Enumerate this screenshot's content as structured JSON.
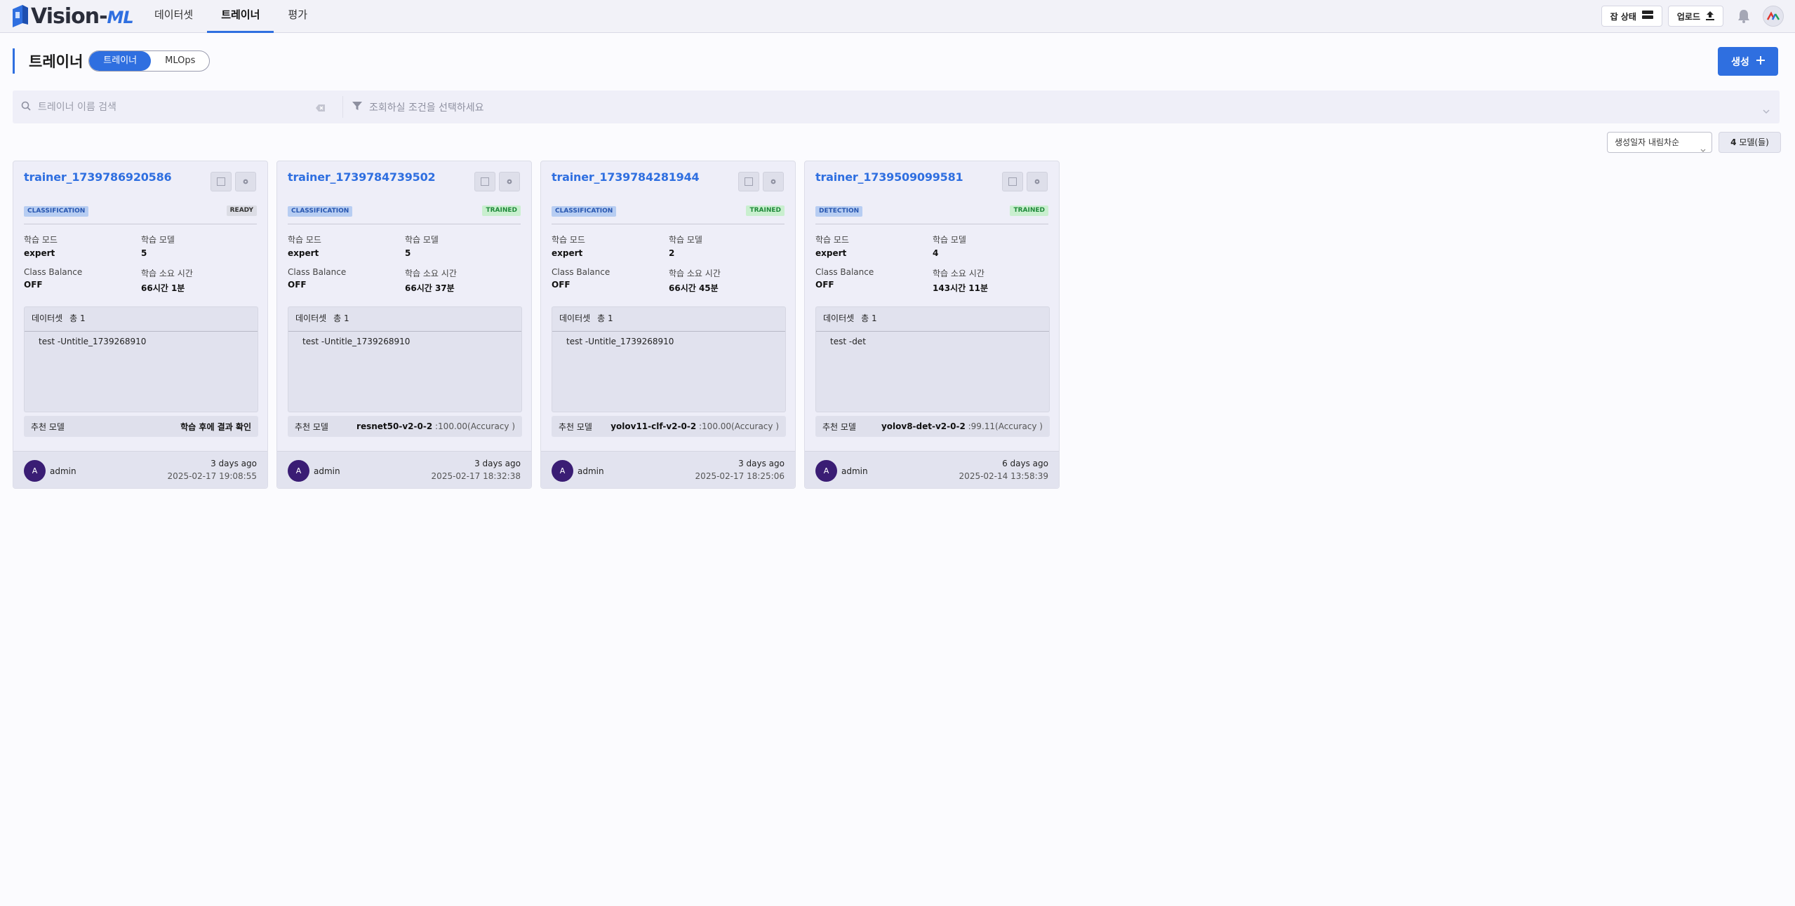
{
  "header": {
    "logo": {
      "text_main": "Vision-",
      "text_accent": "ML"
    },
    "nav": [
      {
        "label": "데이터셋",
        "active": false
      },
      {
        "label": "트레이너",
        "active": true
      },
      {
        "label": "평가",
        "active": false
      }
    ],
    "job_status_label": "잡 상태",
    "upload_label": "업로드"
  },
  "page": {
    "title": "트레이너",
    "toggle": [
      "트레이너",
      "MLOps"
    ],
    "create_label": "생성"
  },
  "filters": {
    "search_placeholder": "트레이너 이름 검색",
    "condition_placeholder": "조회하실 조건을 선택하세요"
  },
  "sort": {
    "selected": "생성일자 내림차순"
  },
  "count": {
    "value": "4",
    "unit": "모델(들)"
  },
  "labels": {
    "mode": "학습 모드",
    "model": "학습 모델",
    "class_balance": "Class Balance",
    "duration": "학습 소요 시간",
    "dataset": "데이터셋",
    "recommended": "추천 모델"
  },
  "cards": [
    {
      "title": "trainer_1739786920586",
      "type": "CLASSIFICATION",
      "status": "READY",
      "mode": "expert",
      "model_count": "5",
      "class_balance": "OFF",
      "duration": "66시간 1분",
      "dataset_total": "총 1",
      "datasets": [
        "test -Untitle_1739268910"
      ],
      "rec_model": "학습 후에 결과 확인",
      "rec_score": "",
      "author": "admin",
      "avatar": "A",
      "ago": "3 days ago",
      "timestamp": "2025-02-17 19:08:55"
    },
    {
      "title": "trainer_1739784739502",
      "type": "CLASSIFICATION",
      "status": "TRAINED",
      "mode": "expert",
      "model_count": "5",
      "class_balance": "OFF",
      "duration": "66시간 37분",
      "dataset_total": "총 1",
      "datasets": [
        "test -Untitle_1739268910"
      ],
      "rec_model": "resnet50-v2-0-2",
      "rec_score": " :100.00(Accuracy )",
      "author": "admin",
      "avatar": "A",
      "ago": "3 days ago",
      "timestamp": "2025-02-17 18:32:38"
    },
    {
      "title": "trainer_1739784281944",
      "type": "CLASSIFICATION",
      "status": "TRAINED",
      "mode": "expert",
      "model_count": "2",
      "class_balance": "OFF",
      "duration": "66시간 45분",
      "dataset_total": "총 1",
      "datasets": [
        "test -Untitle_1739268910"
      ],
      "rec_model": "yolov11-clf-v2-0-2",
      "rec_score": " :100.00(Accuracy )",
      "author": "admin",
      "avatar": "A",
      "ago": "3 days ago",
      "timestamp": "2025-02-17 18:25:06"
    },
    {
      "title": "trainer_1739509099581",
      "type": "DETECTION",
      "status": "TRAINED",
      "mode": "expert",
      "model_count": "4",
      "class_balance": "OFF",
      "duration": "143시간 11분",
      "dataset_total": "총 1",
      "datasets": [
        "test -det"
      ],
      "rec_model": "yolov8-det-v2-0-2",
      "rec_score": " :99.11(Accuracy )",
      "author": "admin",
      "avatar": "A",
      "ago": "6 days ago",
      "timestamp": "2025-02-14 13:58:39"
    }
  ],
  "colors": {
    "accent": "#2f6fe0",
    "avatar": "#3a1d74",
    "trained": "#1f8a3a"
  }
}
